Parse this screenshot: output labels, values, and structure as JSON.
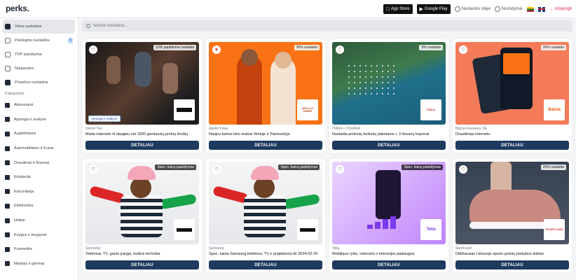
{
  "header": {
    "logo": "perks.",
    "appstore": "App Store",
    "googleplay": "Google Play",
    "idea_link": "Nuolaidos idėja",
    "settings_link": "Nustatymai",
    "logout": "Atsijungti"
  },
  "search": {
    "placeholder": "Ieškoti nuolaidos..."
  },
  "sidebar": {
    "items": [
      {
        "label": "Visos nuolaidos"
      },
      {
        "label": "Pamėgtos nuolaidos",
        "badge": "5"
      },
      {
        "label": "TOP pasiūlymai"
      },
      {
        "label": "Naujausios"
      },
      {
        "label": "Privačios nuolaidos"
      }
    ],
    "categories_heading": "Kategorijos",
    "categories": [
      {
        "label": "Aksesuarai"
      },
      {
        "label": "Apranga ir avalynė"
      },
      {
        "label": "Augintiniams"
      },
      {
        "label": "Automobiliams ir Kuras"
      },
      {
        "label": "Draudimai ir finansai"
      },
      {
        "label": "Edukacija"
      },
      {
        "label": "Kanceliarija"
      },
      {
        "label": "Elektronika"
      },
      {
        "label": "Hobiai"
      },
      {
        "label": "Knygos ir knygynai"
      },
      {
        "label": "Kosmetika"
      },
      {
        "label": "Maistas ir gėrimai"
      }
    ]
  },
  "cards": [
    {
      "discount": "15% papildoma nuolaida",
      "partner": "Iškrovi Yes",
      "description": "Mada internete iš daugiau nei 1500 garsiausių prekių ženklų",
      "logo_text": "",
      "extra_tag": "Apranga ir avalynė",
      "button": "DETALIAU"
    },
    {
      "discount": "30% nuolaida",
      "partner": "Apollo Kinas",
      "description": "Naujos kartos kino teatrai Vilniuje ir Panevėžyje",
      "logo_text": "APOLLO KINAS",
      "extra_tag": "",
      "button": "DETALIAU"
    },
    {
      "discount": "5% nuolaida",
      "partner": "ITAKA + OSVANA",
      "description": "Nuolaida poilsinių kelionių paketams + 3 dovanų kuponai",
      "logo_text": "ITAKA",
      "extra_tag": "",
      "button": "DETALIAU"
    },
    {
      "discount": "20% nuolaida",
      "partner": "Balcia Insurance SE",
      "description": "Draudimas internetu",
      "logo_text": "Balcia",
      "extra_tag": "",
      "button": "DETALIAU"
    },
    {
      "discount": "Spec. kainų pasiūlymas",
      "partner": "Samsung",
      "description": "Telefonai, TV, garso įranga, buitinė technika",
      "logo_text": "SAMSUNG",
      "extra_tag": "",
      "button": "DETALIAU"
    },
    {
      "discount": "Spec. kainų pasiūlymas",
      "partner": "Samsung",
      "description": "Spec. kaina Samsung telefonui, TV ir projektoriui iki 2024-02-29",
      "logo_text": "SAMSUNG",
      "extra_tag": "",
      "button": "DETALIAU"
    },
    {
      "discount": "Spec. kainų pasiūlymas",
      "partner": "Telia",
      "description": "Mobiliaus ryšio, interneto ir televizijos paslaugos",
      "logo_text": "Telia",
      "extra_tag": "",
      "button": "DETALIAU"
    },
    {
      "discount": "25% nuolaida",
      "partner": "SportLand",
      "description": "Didžiausias Lietuvoje sporto prekių prekybos tinklas",
      "logo_text": "SPORTLAND",
      "extra_tag": "",
      "button": "DETALIAU"
    }
  ]
}
